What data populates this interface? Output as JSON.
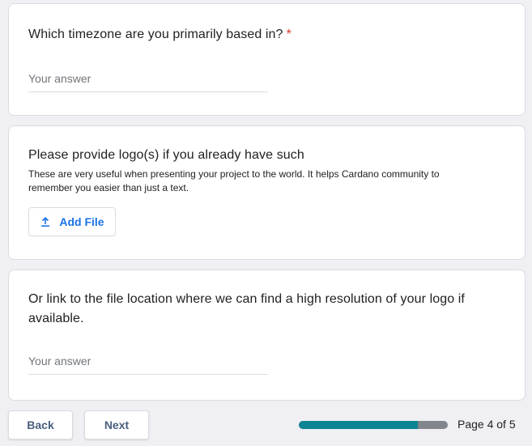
{
  "questions": [
    {
      "title": "Which timezone are you primarily based in?",
      "required_mark": "*",
      "placeholder": "Your answer"
    },
    {
      "title": "Please provide logo(s) if you already have such",
      "description": "These are very useful when presenting your project to the world. It helps Cardano community to remember you easier than just a text.",
      "button_label": "Add File",
      "button_icon": "upload-icon"
    },
    {
      "title": "Or link to the file location where we can find a high resolution of your logo if available.",
      "placeholder": "Your answer"
    }
  ],
  "footer": {
    "back_label": "Back",
    "next_label": "Next",
    "page_label": "Page 4 of 5",
    "progress_fraction": 0.8
  },
  "colors": {
    "accent": "#1a73e8",
    "progress": "#0c8491",
    "required": "#d93025",
    "background": "#f0f0f4"
  }
}
